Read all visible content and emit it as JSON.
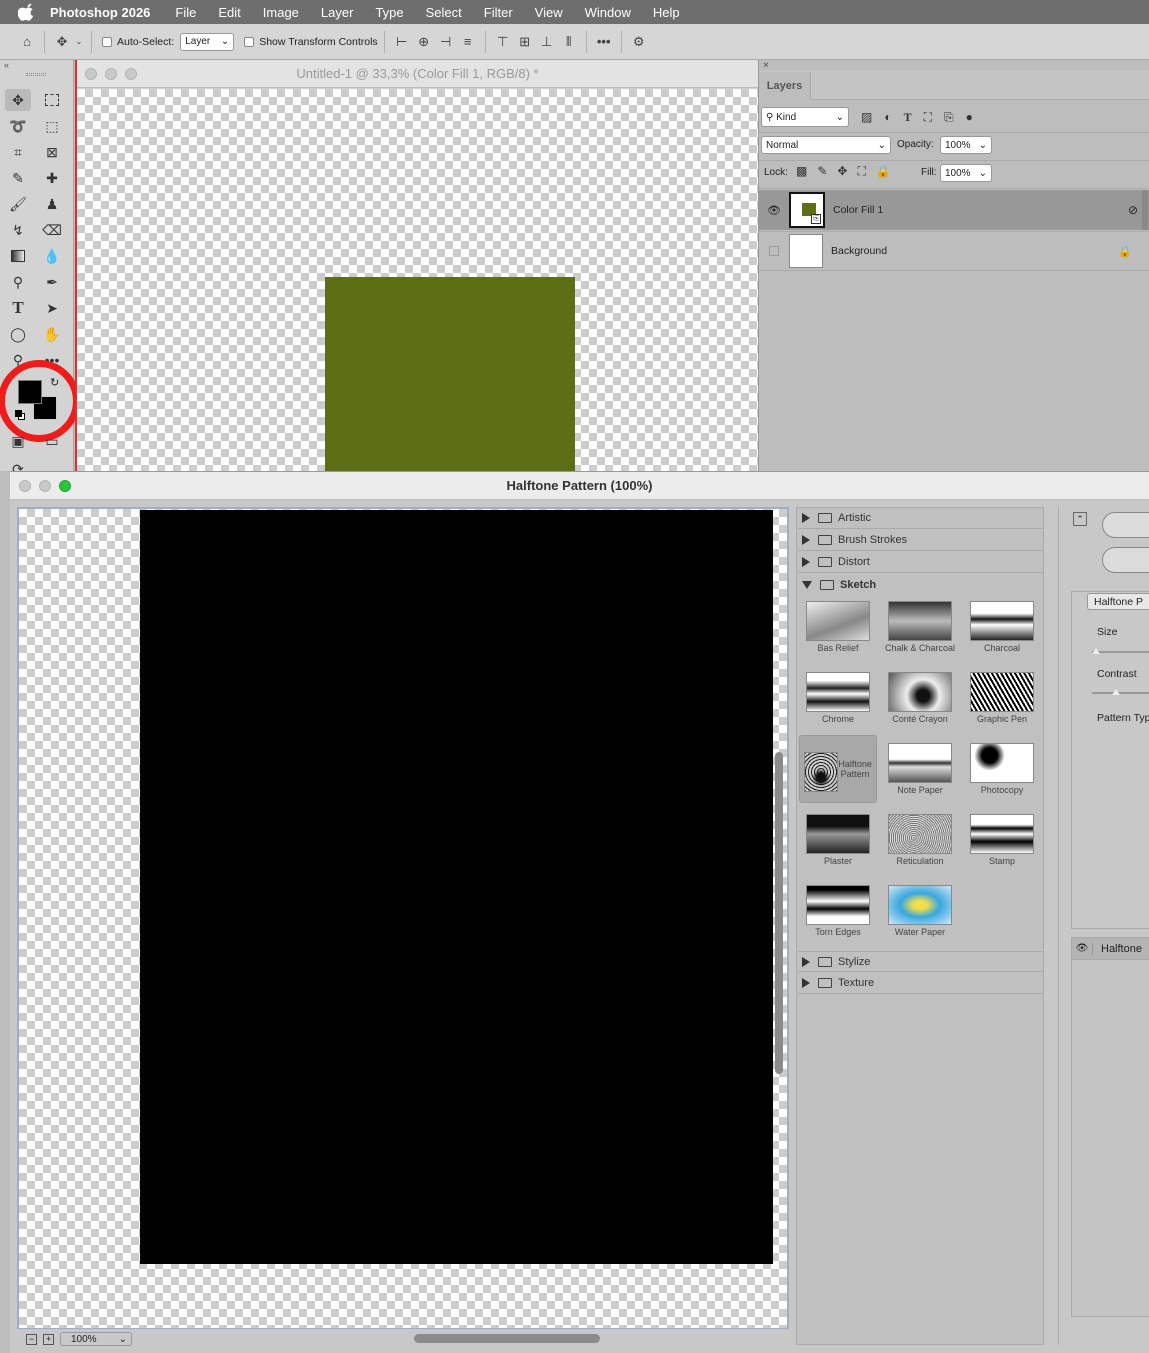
{
  "menubar": {
    "app_name": "Photoshop 2026",
    "items": [
      "File",
      "Edit",
      "Image",
      "Layer",
      "Type",
      "Select",
      "Filter",
      "View",
      "Window",
      "Help"
    ]
  },
  "options": {
    "auto_select_label": "Auto-Select:",
    "auto_select_value": "Layer",
    "transform_label": "Show Transform Controls"
  },
  "document": {
    "title": "Untitled-1 @ 33,3% (Color Fill 1, RGB/8) *",
    "fill_color": "#5d6e14"
  },
  "layers": {
    "tab": "Layers",
    "kind": "Kind",
    "blend": "Normal",
    "opacity_label": "Opacity:",
    "opacity": "100%",
    "lock_label": "Lock:",
    "fill_label": "Fill:",
    "fill": "100%",
    "items": [
      {
        "name": "Color Fill 1"
      },
      {
        "name": "Background"
      }
    ]
  },
  "dialog": {
    "title": "Halftone Pattern (100%)",
    "zoom": "100%",
    "categories_top": [
      "Artistic",
      "Brush Strokes",
      "Distort"
    ],
    "open_category": "Sketch",
    "filters": [
      "Bas Relief",
      "Chalk & Charcoal",
      "Charcoal",
      "Chrome",
      "Conté Crayon",
      "Graphic Pen",
      "Halftone Pattern",
      "Note Paper",
      "Photocopy",
      "Plaster",
      "Reticulation",
      "Stamp",
      "Torn Edges",
      "Water Paper"
    ],
    "categories_bottom": [
      "Stylize",
      "Texture"
    ],
    "filter_select": "Halftone P",
    "size_label": "Size",
    "contrast_label": "Contrast",
    "pattern_label": "Pattern Typ",
    "effect_layer": "Halftone"
  }
}
